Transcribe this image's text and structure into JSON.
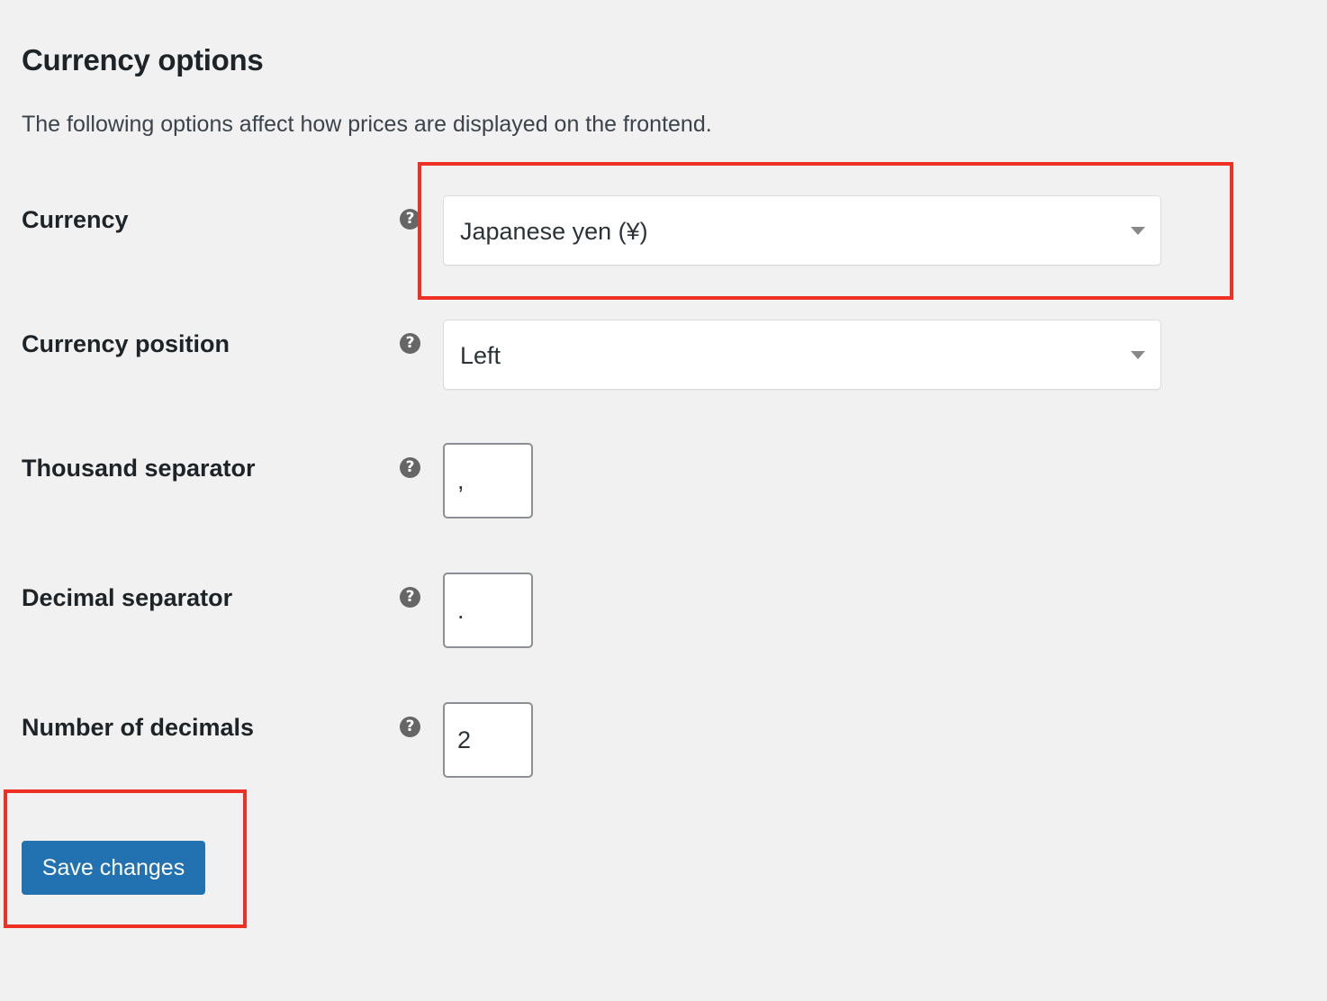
{
  "section": {
    "title": "Currency options",
    "description": "The following options affect how prices are displayed on the frontend."
  },
  "fields": {
    "currency": {
      "label": "Currency",
      "help_icon": "question-circle-icon",
      "value": "Japanese yen (¥)",
      "arrow_icon": "caret-down-icon"
    },
    "currency_position": {
      "label": "Currency position",
      "help_icon": "question-circle-icon",
      "value": "Left",
      "arrow_icon": "caret-down-icon"
    },
    "thousand_separator": {
      "label": "Thousand separator",
      "help_icon": "question-circle-icon",
      "value": ","
    },
    "decimal_separator": {
      "label": "Decimal separator",
      "help_icon": "question-circle-icon",
      "value": "."
    },
    "number_of_decimals": {
      "label": "Number of decimals",
      "help_icon": "question-circle-icon",
      "value": "2"
    }
  },
  "help_glyph": "?",
  "actions": {
    "save_label": "Save changes"
  },
  "colors": {
    "background": "#f1f1f1",
    "primary_button": "#2271b1",
    "highlight": "#ee3124",
    "help_icon": "#666666"
  }
}
